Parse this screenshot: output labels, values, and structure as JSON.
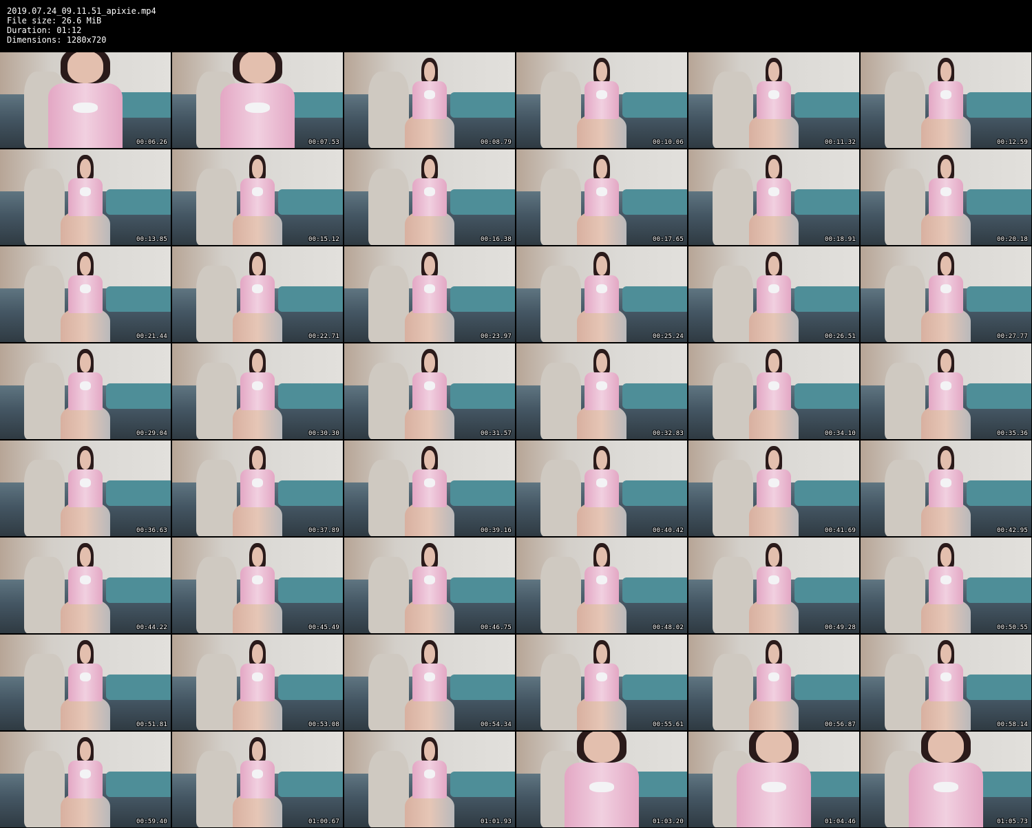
{
  "header": {
    "filename": "2019.07.24_09.11.51_apixie.mp4",
    "file_size": "File size: 26.6 MiB",
    "duration": "Duration: 01:12",
    "dimensions": "Dimensions: 1280x720"
  },
  "thumbnails": [
    {
      "time": "00:06.26",
      "shot": "close"
    },
    {
      "time": "00:07.53",
      "shot": "close"
    },
    {
      "time": "00:08.79",
      "shot": "wide"
    },
    {
      "time": "00:10.06",
      "shot": "wide"
    },
    {
      "time": "00:11.32",
      "shot": "wide"
    },
    {
      "time": "00:12.59",
      "shot": "wide"
    },
    {
      "time": "00:13.85",
      "shot": "wide"
    },
    {
      "time": "00:15.12",
      "shot": "wide"
    },
    {
      "time": "00:16.38",
      "shot": "wide"
    },
    {
      "time": "00:17.65",
      "shot": "wide"
    },
    {
      "time": "00:18.91",
      "shot": "wide"
    },
    {
      "time": "00:20.18",
      "shot": "wide"
    },
    {
      "time": "00:21.44",
      "shot": "wide"
    },
    {
      "time": "00:22.71",
      "shot": "wide"
    },
    {
      "time": "00:23.97",
      "shot": "wide"
    },
    {
      "time": "00:25.24",
      "shot": "wide"
    },
    {
      "time": "00:26.51",
      "shot": "wide"
    },
    {
      "time": "00:27.77",
      "shot": "wide"
    },
    {
      "time": "00:29.04",
      "shot": "wide"
    },
    {
      "time": "00:30.30",
      "shot": "wide"
    },
    {
      "time": "00:31.57",
      "shot": "wide"
    },
    {
      "time": "00:32.83",
      "shot": "wide"
    },
    {
      "time": "00:34.10",
      "shot": "wide"
    },
    {
      "time": "00:35.36",
      "shot": "wide"
    },
    {
      "time": "00:36.63",
      "shot": "wide"
    },
    {
      "time": "00:37.89",
      "shot": "wide"
    },
    {
      "time": "00:39.16",
      "shot": "wide"
    },
    {
      "time": "00:40.42",
      "shot": "wide"
    },
    {
      "time": "00:41.69",
      "shot": "wide"
    },
    {
      "time": "00:42.95",
      "shot": "wide"
    },
    {
      "time": "00:44.22",
      "shot": "wide"
    },
    {
      "time": "00:45.49",
      "shot": "wide"
    },
    {
      "time": "00:46.75",
      "shot": "wide"
    },
    {
      "time": "00:48.02",
      "shot": "wide"
    },
    {
      "time": "00:49.28",
      "shot": "wide"
    },
    {
      "time": "00:50.55",
      "shot": "wide"
    },
    {
      "time": "00:51.81",
      "shot": "wide"
    },
    {
      "time": "00:53.08",
      "shot": "wide"
    },
    {
      "time": "00:54.34",
      "shot": "wide"
    },
    {
      "time": "00:55.61",
      "shot": "wide"
    },
    {
      "time": "00:56.87",
      "shot": "wide"
    },
    {
      "time": "00:58.14",
      "shot": "wide"
    },
    {
      "time": "00:59.40",
      "shot": "wide"
    },
    {
      "time": "01:00.67",
      "shot": "wide"
    },
    {
      "time": "01:01.93",
      "shot": "wide"
    },
    {
      "time": "01:03.20",
      "shot": "close"
    },
    {
      "time": "01:04.46",
      "shot": "close"
    },
    {
      "time": "01:05.73",
      "shot": "close"
    }
  ],
  "colors": {
    "background": "#000000",
    "text": "#ffffff"
  }
}
